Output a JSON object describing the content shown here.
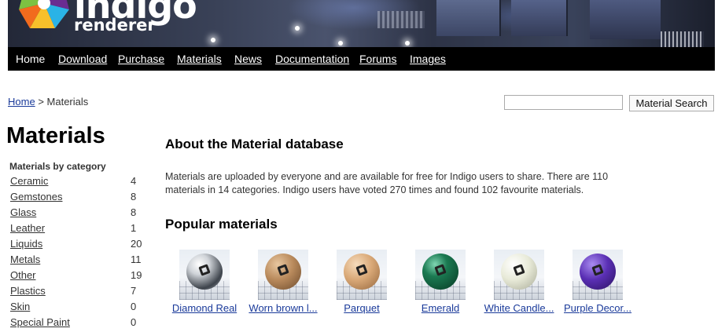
{
  "brand": {
    "name": "indigo",
    "tagline": "renderer"
  },
  "nav": {
    "items": [
      "Home",
      "Download",
      "Purchase",
      "Materials",
      "News",
      "Documentation",
      "Forums",
      "Images"
    ]
  },
  "breadcrumb": {
    "home": "Home",
    "separator": ">",
    "current": "Materials"
  },
  "search": {
    "value": "",
    "button_label": "Material Search"
  },
  "sidebar": {
    "title": "Materials",
    "subtitle": "Materials by category",
    "categories": [
      {
        "name": "Ceramic",
        "count": "4"
      },
      {
        "name": "Gemstones",
        "count": "8"
      },
      {
        "name": "Glass",
        "count": "8"
      },
      {
        "name": "Leather",
        "count": "1"
      },
      {
        "name": "Liquids",
        "count": "20"
      },
      {
        "name": "Metals",
        "count": "11"
      },
      {
        "name": "Other",
        "count": "19"
      },
      {
        "name": "Plastics",
        "count": "7"
      },
      {
        "name": "Skin",
        "count": "0"
      },
      {
        "name": "Special Paint",
        "count": "0"
      }
    ]
  },
  "main": {
    "about_heading": "About the Material database",
    "about_text": "Materials are uploaded by everyone and are available for free for Indigo users to share. There are 110 materials in 14 categories. Indigo users have voted 270 times and found 102 favourite materials.",
    "popular_heading": "Popular materials",
    "popular": [
      {
        "label": "Diamond Real",
        "color": "#cfd3d8"
      },
      {
        "label": "Worn brown l...",
        "color": "#b98a5c"
      },
      {
        "label": "Parquet",
        "color": "#d9a877"
      },
      {
        "label": "Emerald",
        "color": "#0f5a3a"
      },
      {
        "label": "White Candle...",
        "color": "#e8ead8"
      },
      {
        "label": "Purple Decor...",
        "color": "#5a2fb4"
      }
    ]
  },
  "colors": {
    "link": "#1a3a9a",
    "nav_bg": "#000000",
    "accent_logo_orange": "#f26b1d",
    "accent_logo_purple": "#6a2c91"
  }
}
